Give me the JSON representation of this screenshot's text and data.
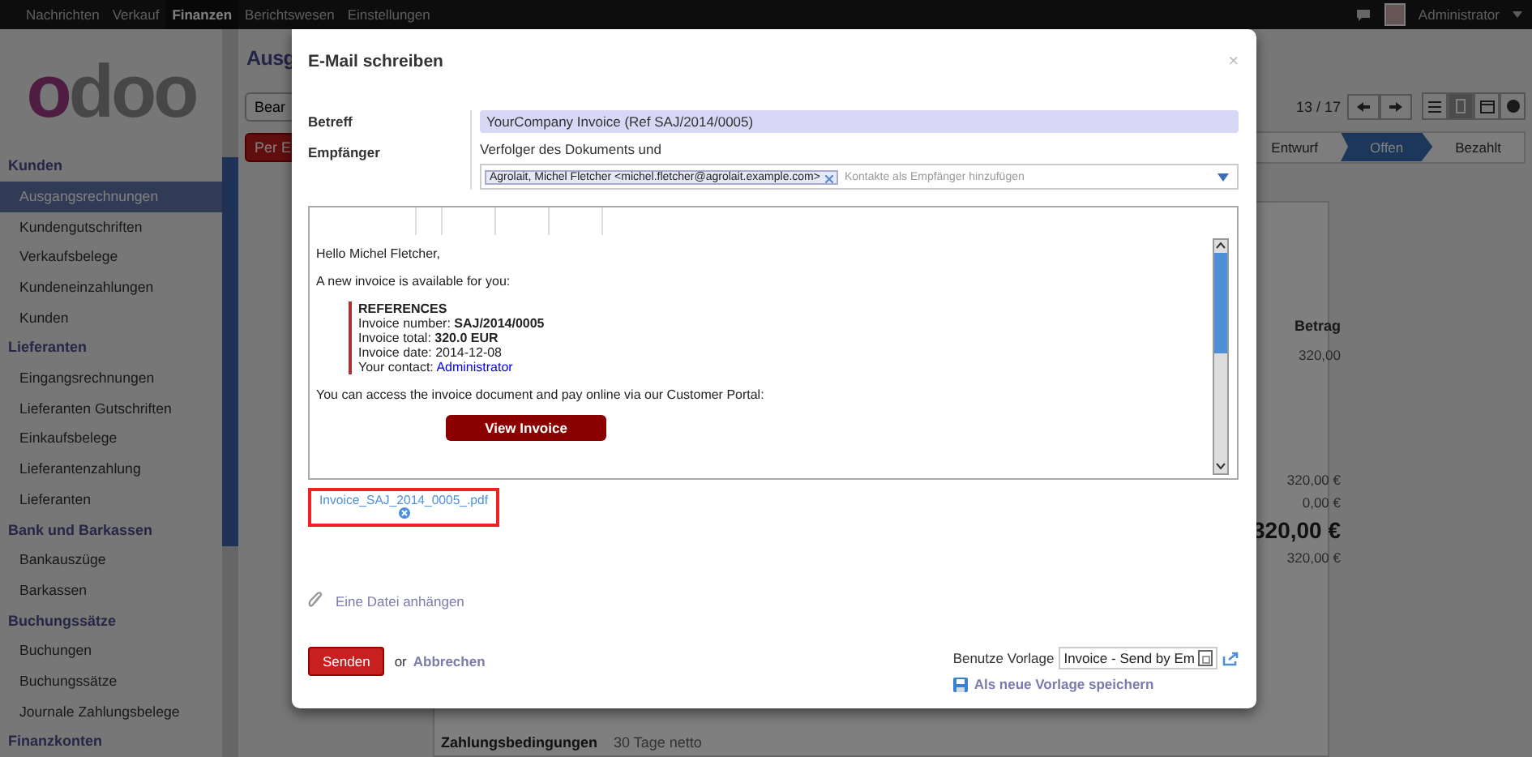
{
  "top_menu": [
    {
      "label": "Nachrichten",
      "selected": false
    },
    {
      "label": "Verkauf",
      "selected": false
    },
    {
      "label": "Finanzen",
      "selected": true
    },
    {
      "label": "Berichtswesen",
      "selected": false
    },
    {
      "label": "Einstellungen",
      "selected": false
    }
  ],
  "user": {
    "name": "Administrator"
  },
  "logo": "odoo",
  "sidebar": {
    "sections": [
      {
        "title": "Kunden",
        "items": [
          {
            "label": "Ausgangsrechnungen",
            "selected": true
          },
          {
            "label": "Kundengutschriften",
            "selected": false
          },
          {
            "label": "Verkaufsbelege",
            "selected": false
          },
          {
            "label": "Kundeneinzahlungen",
            "selected": false
          },
          {
            "label": "Kunden",
            "selected": false
          }
        ]
      },
      {
        "title": "Lieferanten",
        "items": [
          {
            "label": "Eingangsrechnungen",
            "selected": false
          },
          {
            "label": "Lieferanten Gutschriften",
            "selected": false
          },
          {
            "label": "Einkaufsbelege",
            "selected": false
          },
          {
            "label": "Lieferantenzahlung",
            "selected": false
          },
          {
            "label": "Lieferanten",
            "selected": false
          }
        ]
      },
      {
        "title": "Bank und Barkassen",
        "items": [
          {
            "label": "Bankauszüge",
            "selected": false
          },
          {
            "label": "Barkassen",
            "selected": false
          }
        ]
      },
      {
        "title": "Buchungssätze",
        "items": [
          {
            "label": "Buchungen",
            "selected": false
          },
          {
            "label": "Buchungssätze",
            "selected": false
          },
          {
            "label": "Journale Zahlungsbelege",
            "selected": false
          }
        ]
      },
      {
        "title": "Finanzkonten"
      }
    ]
  },
  "main": {
    "title": "Ausg",
    "edit_button": "Bear",
    "email_button": "Per E",
    "pager": "13 / 17",
    "views": [
      {
        "kind": "list",
        "selected": false
      },
      {
        "kind": "form",
        "selected": true
      },
      {
        "kind": "calendar",
        "selected": false
      },
      {
        "kind": "graph",
        "selected": false
      }
    ],
    "stages": [
      {
        "label": "Entwurf",
        "selected": false
      },
      {
        "label": "Offen",
        "selected": true
      },
      {
        "label": "Bezahlt",
        "selected": false
      }
    ],
    "amount_header": "Betrag",
    "line_amount": "320,00",
    "totals": [
      {
        "value": "320,00 €",
        "kind": "normal"
      },
      {
        "value": "0,00 €",
        "kind": "normal"
      },
      {
        "value": "320,00 €",
        "kind": "grand"
      },
      {
        "value": "320,00 €",
        "kind": "normal"
      }
    ],
    "payment_term_label": "Zahlungsbedingungen",
    "payment_term": "30 Tage netto"
  },
  "dialog": {
    "title": "E-Mail schreiben",
    "close": "×",
    "subject_label": "Betreff",
    "subject": "YourCompany Invoice (Ref SAJ/2014/0005)",
    "recipients_label": "Empfänger",
    "followers_note": "Verfolger des Dokuments und",
    "recipient_tags": [
      "Agrolait, Michel Fletcher <michel.fletcher@agrolait.example.com>"
    ],
    "recipients_placeholder": "Kontakte als Empfänger hinzufügen",
    "body": {
      "greeting": "Hello Michel Fletcher,",
      "intro": "A new invoice is available for you:",
      "references": [
        "**REFERENCES**",
        "Invoice number: **SAJ/2014/0005**",
        "Invoice total: **320.0 EUR**",
        "Invoice date: 2014-12-08"
      ],
      "contact_label": "Your contact:",
      "contact_link": "Administrator",
      "portal_note": "You can access the invoice document and pay online via our Customer Portal:",
      "button": "View Invoice"
    },
    "attachments": [
      {
        "name": "Invoice_SAJ_2014_0005_.pdf"
      }
    ],
    "attach_link": "Eine Datei anhängen",
    "send_button": "Senden",
    "or": "or",
    "cancel": "Abbrechen",
    "template_label": "Benutze Vorlage",
    "template": "Invoice - Send by Em",
    "save_template": "Als neue Vorlage speichern"
  }
}
